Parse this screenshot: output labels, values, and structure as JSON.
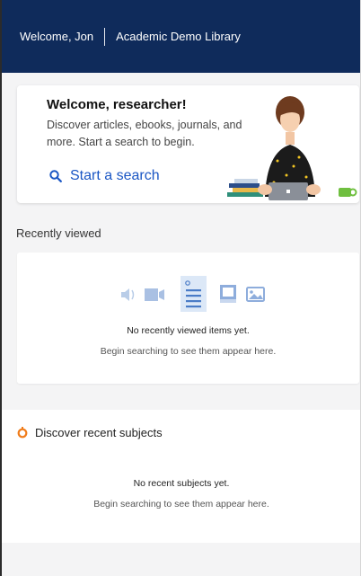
{
  "header": {
    "greeting": "Welcome, Jon",
    "library_name": "Academic Demo Library",
    "bg_color": "#0f2b5b"
  },
  "hero": {
    "title": "Welcome, researcher!",
    "description": "Discover articles, ebooks, journals, and more. Start a search to begin.",
    "cta_label": "Start a search",
    "cta_icon": "search-icon",
    "accent_color": "#1a56c4"
  },
  "recently_viewed": {
    "heading": "Recently viewed",
    "icons": [
      "audio-icon",
      "video-icon",
      "document-icon",
      "book-icon",
      "image-icon"
    ],
    "empty_title": "No recently viewed items yet.",
    "empty_hint": "Begin searching to see them appear here."
  },
  "subjects": {
    "heading": "Discover recent subjects",
    "icon": "subjects-icon",
    "icon_color": "#f07c1a",
    "empty_title": "No recent subjects yet.",
    "empty_hint": "Begin searching to see them appear here."
  }
}
